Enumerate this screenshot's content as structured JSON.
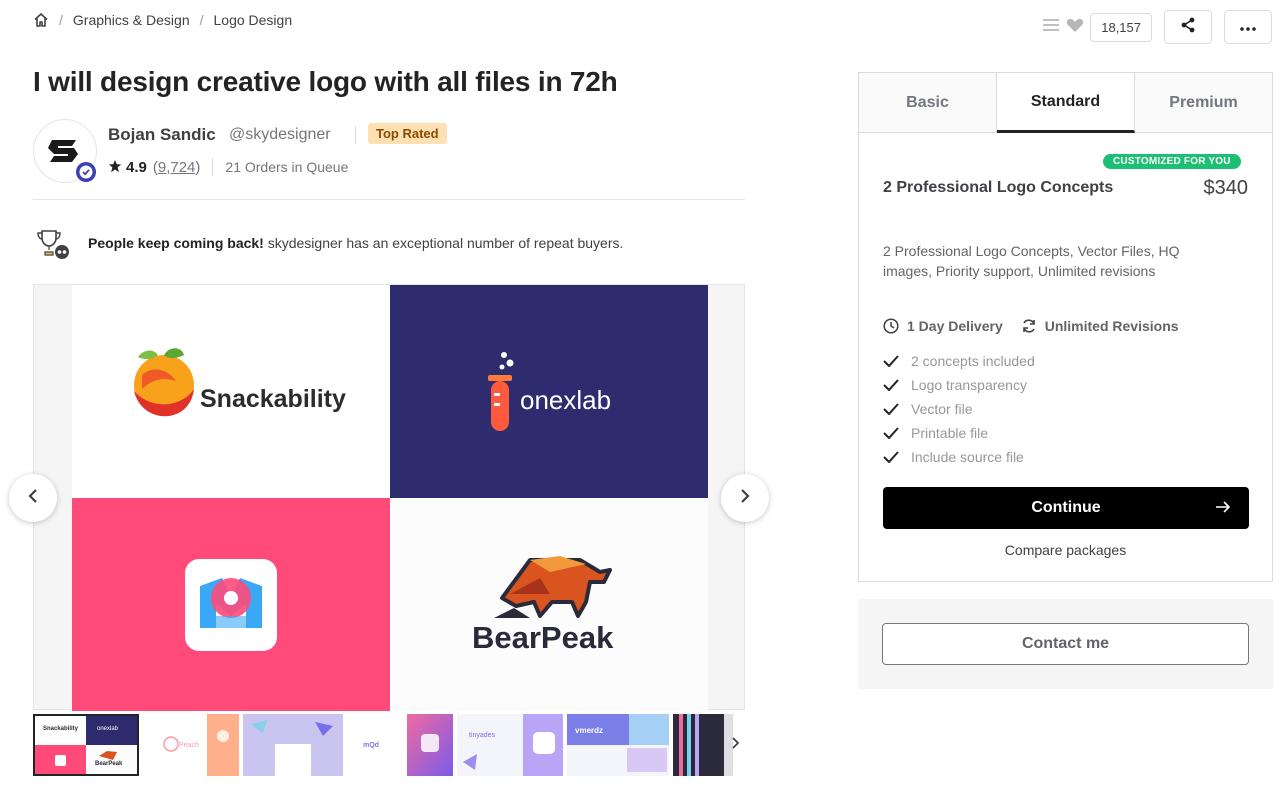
{
  "breadcrumb": {
    "home_icon": "home-icon",
    "items": [
      "Graphics & Design",
      "Logo Design"
    ]
  },
  "top_actions": {
    "favorites_count": "18,157",
    "icons": [
      "list-icon",
      "heart-icon",
      "share-icon",
      "more-icon"
    ]
  },
  "gig": {
    "title": "I will design creative logo with all files in 72h"
  },
  "seller": {
    "name": "Bojan Sandic",
    "handle": "@skydesigner",
    "badge": "Top Rated",
    "rating": "4.9",
    "reviews_open": "(",
    "reviews": "9,724",
    "reviews_close": ")",
    "queue": "21 Orders in Queue"
  },
  "repeat_buyers": {
    "bold": "People keep coming back!",
    "text": " skydesigner has an exceptional number of repeat buyers."
  },
  "gallery": {
    "tiles": [
      {
        "word": "Snackability"
      },
      {
        "word": "onexlab"
      },
      {
        "word": ""
      },
      {
        "word": "BearPeak"
      }
    ],
    "thumb_labels": [
      "Snackability",
      "onexlab",
      "BearPeak",
      "Peach",
      "mQd",
      "tinyades",
      "vmerdz"
    ]
  },
  "packages": {
    "tabs": [
      "Basic",
      "Standard",
      "Premium"
    ],
    "active_tab": "Standard",
    "badge": "CUSTOMIZED FOR YOU",
    "title": "2 Professional Logo Concepts",
    "price": "$340",
    "description": "2 Professional Logo Concepts, Vector Files, HQ images, Priority support, Unlimited revisions",
    "delivery": "1 Day Delivery",
    "revisions": "Unlimited Revisions",
    "features": [
      "2 concepts included",
      "Logo transparency",
      "Vector file",
      "Printable file",
      "Include source file"
    ],
    "continue_label": "Continue",
    "compare_label": "Compare packages"
  },
  "contact": {
    "label": "Contact me"
  },
  "colors": {
    "accent_green": "#1dbf73",
    "top_rated_bg": "#ffe0b3",
    "dark": "#222325",
    "tile_navy": "#2e2b6e",
    "tile_pink": "#ff4a7a"
  }
}
